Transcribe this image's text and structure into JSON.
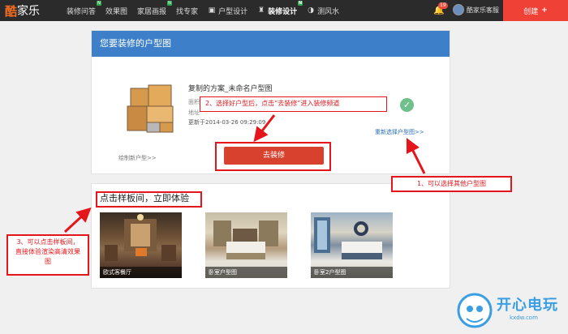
{
  "nav": {
    "logo_mark": "酷",
    "logo_rest": "家乐",
    "items": [
      {
        "label": "装修问答",
        "new": "N"
      },
      {
        "label": "效果图",
        "new": ""
      },
      {
        "label": "家居画报",
        "new": "N"
      },
      {
        "label": "找专家",
        "new": ""
      },
      {
        "label": "户型设计",
        "new": ""
      },
      {
        "label": "装修设计",
        "new": "N"
      },
      {
        "label": "测风水",
        "new": ""
      }
    ],
    "notification_count": "19",
    "user_name": "酷家乐客服",
    "create_label": "创建",
    "create_plus": "+"
  },
  "plan_card": {
    "header": "您要装修的户型图",
    "plan_name": "复制的方案_未命名户型图",
    "meta_line_1": "面积",
    "meta_line_2": "地址",
    "updated": "更新于2014-03-26 09:29:09",
    "rechoose_label": "重新选择户型图>>",
    "draw_new_label": "绘制新户型>>",
    "go_button": "去装修"
  },
  "samples": {
    "title": "点击样板间，立即体验",
    "items": [
      {
        "caption": "欧式客餐厅"
      },
      {
        "caption": "卧室户型图"
      },
      {
        "caption": "卧室2户型图"
      }
    ]
  },
  "annotations": {
    "step1": "1、可以选择其他户型图",
    "step2": "2、选择好户型后，点击“去装修”进入装修频道",
    "step3_line1": "3、可以点击样板间，",
    "step3_line2": "直接体验渲染高清效果",
    "step3_line3": "图"
  },
  "watermark": {
    "text": "开心电玩",
    "sub": "kxdw.com"
  },
  "colors": {
    "topbar": "#2b2b2b",
    "brand_orange": "#f26c22",
    "card_header_blue": "#3d80c9",
    "primary_button": "#d9412f",
    "annotation_red": "#e4161b",
    "check_green": "#6fc08a"
  }
}
